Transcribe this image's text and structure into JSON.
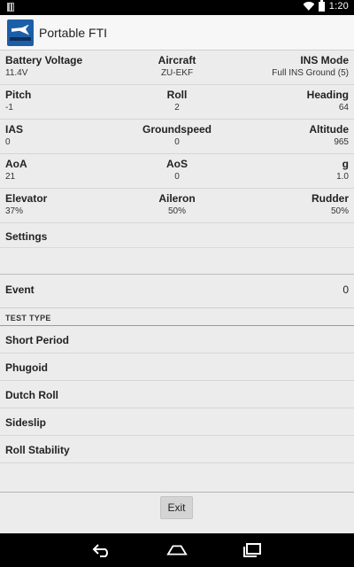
{
  "status_bar": {
    "time": "1:20"
  },
  "app": {
    "title": "Portable FTI"
  },
  "rows": [
    [
      {
        "label": "Battery Voltage",
        "value": "11.4V"
      },
      {
        "label": "Aircraft",
        "value": "ZU-EKF"
      },
      {
        "label": "INS Mode",
        "value": "Full INS Ground (5)"
      }
    ],
    [
      {
        "label": "Pitch",
        "value": "-1"
      },
      {
        "label": "Roll",
        "value": "2"
      },
      {
        "label": "Heading",
        "value": "64"
      }
    ],
    [
      {
        "label": "IAS",
        "value": "0"
      },
      {
        "label": "Groundspeed",
        "value": "0"
      },
      {
        "label": "Altitude",
        "value": "965"
      }
    ],
    [
      {
        "label": "AoA",
        "value": "21"
      },
      {
        "label": "AoS",
        "value": "0"
      },
      {
        "label": "g",
        "value": "1.0"
      }
    ],
    [
      {
        "label": "Elevator",
        "value": "37%"
      },
      {
        "label": "Aileron",
        "value": "50%"
      },
      {
        "label": "Rudder",
        "value": "50%"
      }
    ]
  ],
  "settings": {
    "label": "Settings"
  },
  "event": {
    "label": "Event",
    "value": "0"
  },
  "test_type": {
    "header": "TEST TYPE",
    "items": [
      "Short Period",
      "Phugoid",
      "Dutch Roll",
      "Sideslip",
      "Roll Stability"
    ]
  },
  "exit_label": "Exit"
}
